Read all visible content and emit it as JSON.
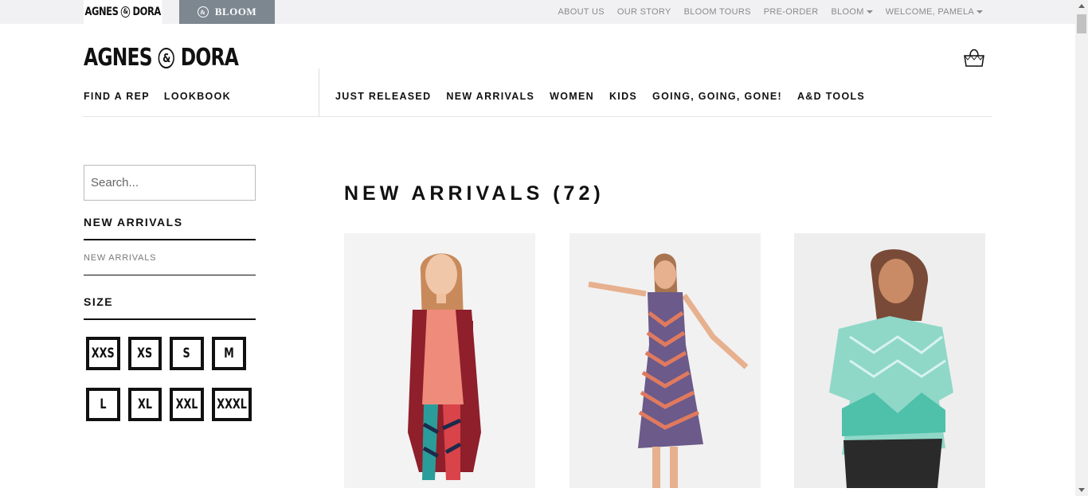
{
  "topbar": {
    "brand_agnes_left": "AGNES",
    "brand_agnes_amp": "&",
    "brand_agnes_right": "DORA",
    "brand_bloom": "BLOOM",
    "utility_links": [
      "ABOUT US",
      "OUR STORY",
      "BLOOM TOURS",
      "PRE-ORDER"
    ],
    "bloom_menu": "BLOOM",
    "welcome": "WELCOME, PAMELA"
  },
  "header": {
    "logo_left": "AGNES",
    "logo_amp": "&",
    "logo_right": "DORA",
    "nav_secondary": [
      "FIND A REP",
      "LOOKBOOK"
    ],
    "nav_main": [
      "JUST RELEASED",
      "NEW ARRIVALS",
      "WOMEN",
      "KIDS",
      "GOING, GOING, GONE!",
      "A&D TOOLS"
    ]
  },
  "sidebar": {
    "search_placeholder": "Search...",
    "category_heading": "NEW ARRIVALS",
    "category_link": "NEW ARRIVALS",
    "size_heading": "SIZE",
    "sizes": [
      "XXS",
      "XS",
      "S",
      "M",
      "L",
      "XL",
      "XXL",
      "XXXL"
    ]
  },
  "main": {
    "title": "NEW ARRIVALS (72)"
  },
  "icons": {
    "cart": "shopping-bag-icon",
    "caret": "caret-down-icon"
  },
  "colors": {
    "bloom_tab": "#7d8790",
    "topbar": "#f1f0f3",
    "text": "#111111",
    "muted": "#8a8a8a"
  }
}
